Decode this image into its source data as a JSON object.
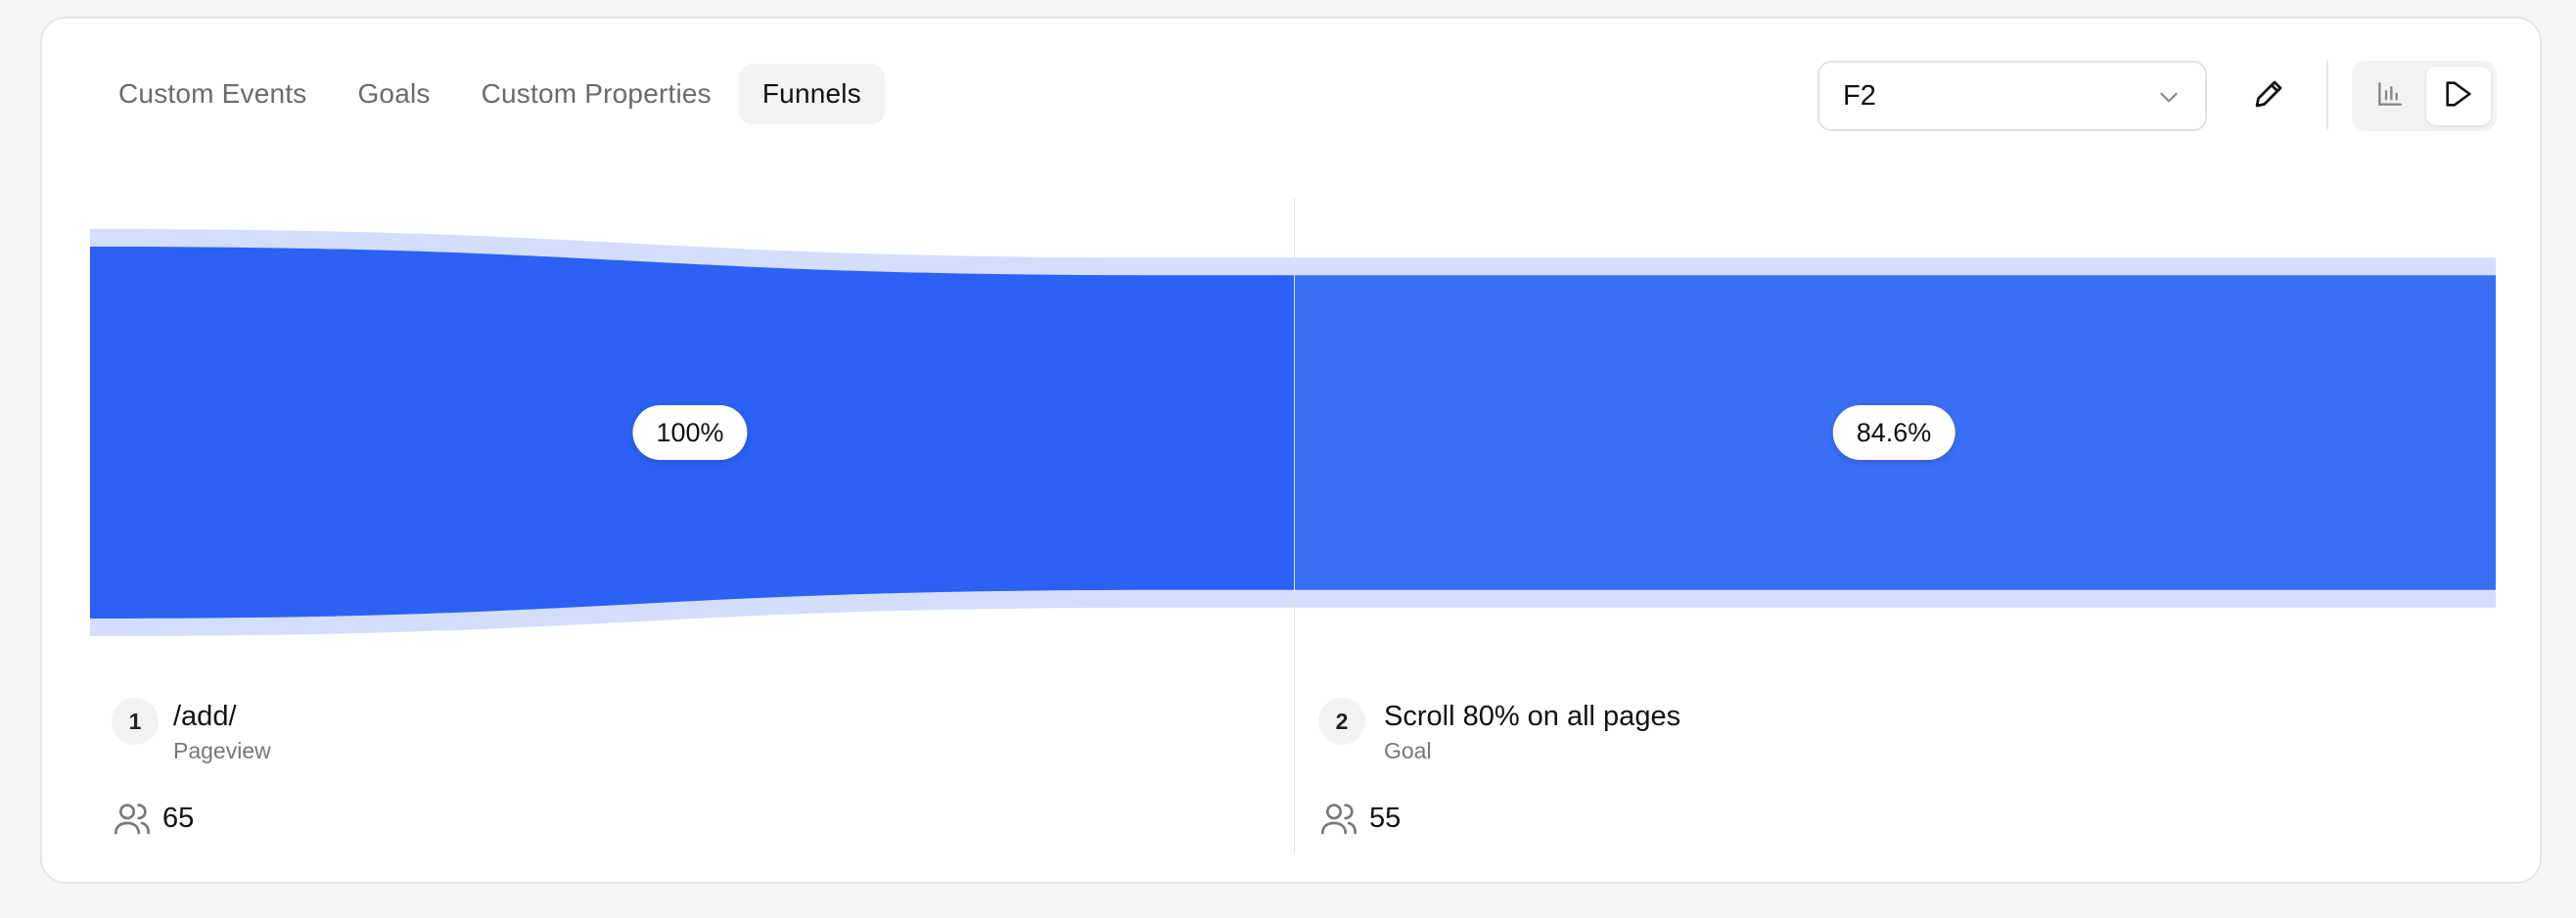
{
  "tabs": [
    {
      "label": "Custom Events",
      "active": false
    },
    {
      "label": "Goals",
      "active": false
    },
    {
      "label": "Custom Properties",
      "active": false
    },
    {
      "label": "Funnels",
      "active": true
    }
  ],
  "funnel_select": {
    "value": "F2"
  },
  "view_toggle": {
    "options": [
      "bar-chart-icon",
      "funnel-icon"
    ],
    "active": "funnel-icon"
  },
  "colors": {
    "bar": "#2b61f4",
    "bar_alt": "#3a6ef4",
    "dropoff": "#d2defc"
  },
  "funnel": {
    "steps": [
      {
        "number": "1",
        "name": "/add/",
        "type": "Pageview",
        "visitors": "65",
        "percent": "100%",
        "value": 100
      },
      {
        "number": "2",
        "name": "Scroll 80% on all pages",
        "type": "Goal",
        "visitors": "55",
        "percent": "84.6%",
        "value": 84.6
      }
    ]
  }
}
